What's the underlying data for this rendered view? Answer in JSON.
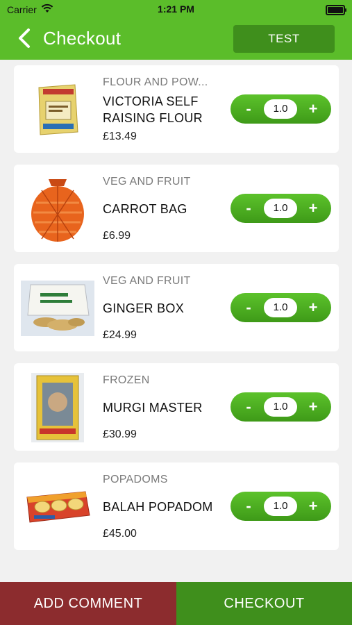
{
  "status_bar": {
    "carrier": "Carrier",
    "time": "1:21 PM"
  },
  "nav": {
    "title": "Checkout",
    "test_button": "TEST"
  },
  "items": [
    {
      "category": "FLOUR AND POW...",
      "name": "VICTORIA SELF RAISING FLOUR",
      "price": "£13.49",
      "quantity": "1.0",
      "image": "flour-bag-image"
    },
    {
      "category": "VEG AND FRUIT",
      "name": "CARROT BAG",
      "price": "£6.99",
      "quantity": "1.0",
      "image": "carrot-bag-image"
    },
    {
      "category": "VEG AND FRUIT",
      "name": "GINGER BOX",
      "price": "£24.99",
      "quantity": "1.0",
      "image": "ginger-box-image"
    },
    {
      "category": "FROZEN",
      "name": "MURGI MASTER",
      "price": "£30.99",
      "quantity": "1.0",
      "image": "murgi-box-image"
    },
    {
      "category": "POPADOMS",
      "name": "BALAH POPADOM",
      "price": "£45.00",
      "quantity": "1.0",
      "image": "popadom-box-image"
    }
  ],
  "stepper": {
    "minus": "-",
    "plus": "+"
  },
  "bottom": {
    "add_comment": "ADD COMMENT",
    "checkout": "CHECKOUT"
  },
  "colors": {
    "brand_green": "#5bbd2a",
    "dark_green": "#3f8f1c",
    "comment_red": "#8c2c2e"
  }
}
